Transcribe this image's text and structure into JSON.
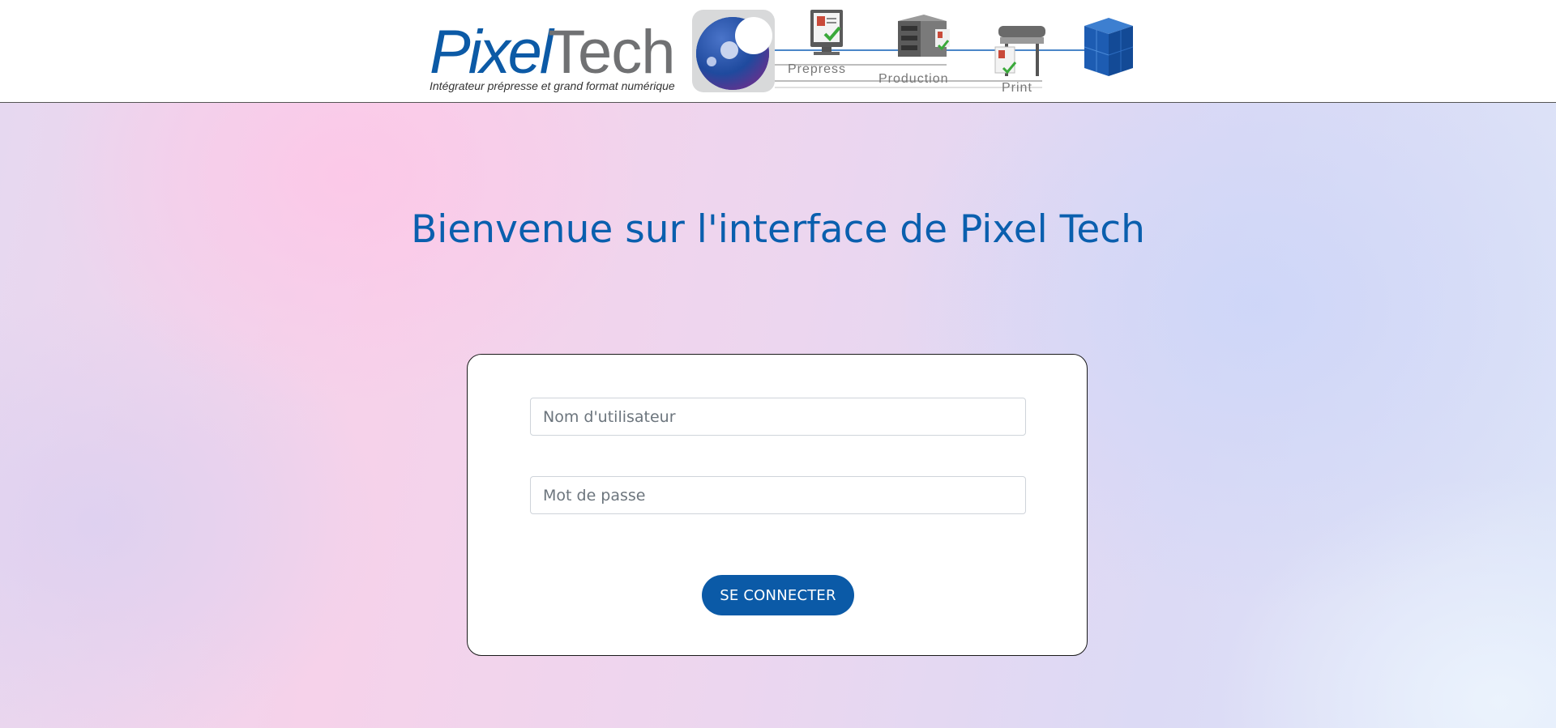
{
  "header": {
    "logo_brand_first": "Pixel",
    "logo_brand_second": "Tech",
    "logo_tagline": "Intégrateur prépresse et grand format numérique",
    "stages": [
      "Prepress",
      "Production",
      "Print"
    ]
  },
  "main": {
    "title": "Bienvenue sur l'interface de Pixel Tech"
  },
  "login": {
    "username_placeholder": "Nom d'utilisateur",
    "username_value": "",
    "password_placeholder": "Mot de passe",
    "password_value": "",
    "submit_label": "SE CONNECTER"
  },
  "colors": {
    "brand_blue": "#0b5aa7",
    "title_blue": "#0a5fae"
  },
  "icons": [
    "logo-orb-icon",
    "monitor-checkmark-icon",
    "server-rack-icon",
    "large-format-printer-icon",
    "blue-cube-icon"
  ]
}
